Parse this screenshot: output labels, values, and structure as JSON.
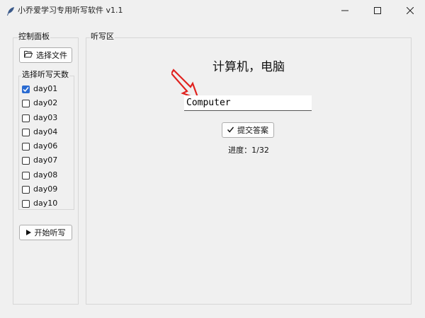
{
  "window": {
    "title": "小乔爱学习专用听写软件 v1.1"
  },
  "control_panel": {
    "label": "控制面板",
    "choose_file_label": "选择文件",
    "days_group_label": "选择听写天数",
    "days": [
      {
        "label": "day01",
        "checked": true
      },
      {
        "label": "day02",
        "checked": false
      },
      {
        "label": "day03",
        "checked": false
      },
      {
        "label": "day04",
        "checked": false
      },
      {
        "label": "day06",
        "checked": false
      },
      {
        "label": "day07",
        "checked": false
      },
      {
        "label": "day08",
        "checked": false
      },
      {
        "label": "day09",
        "checked": false
      },
      {
        "label": "day10",
        "checked": false
      }
    ],
    "start_label": "开始听写"
  },
  "dictation": {
    "label": "听写区",
    "prompt_word": "计算机，电脑",
    "answer_value": "Computer",
    "submit_label": "提交答案",
    "progress_text": "进度：1/32"
  },
  "colors": {
    "accent": "#2a6bd1",
    "annotation_arrow": "#e0221f"
  },
  "icons": {
    "app": "feather-icon",
    "folder": "folder-open-icon",
    "start": "play-triangle-icon",
    "submit": "checkmark-icon"
  }
}
